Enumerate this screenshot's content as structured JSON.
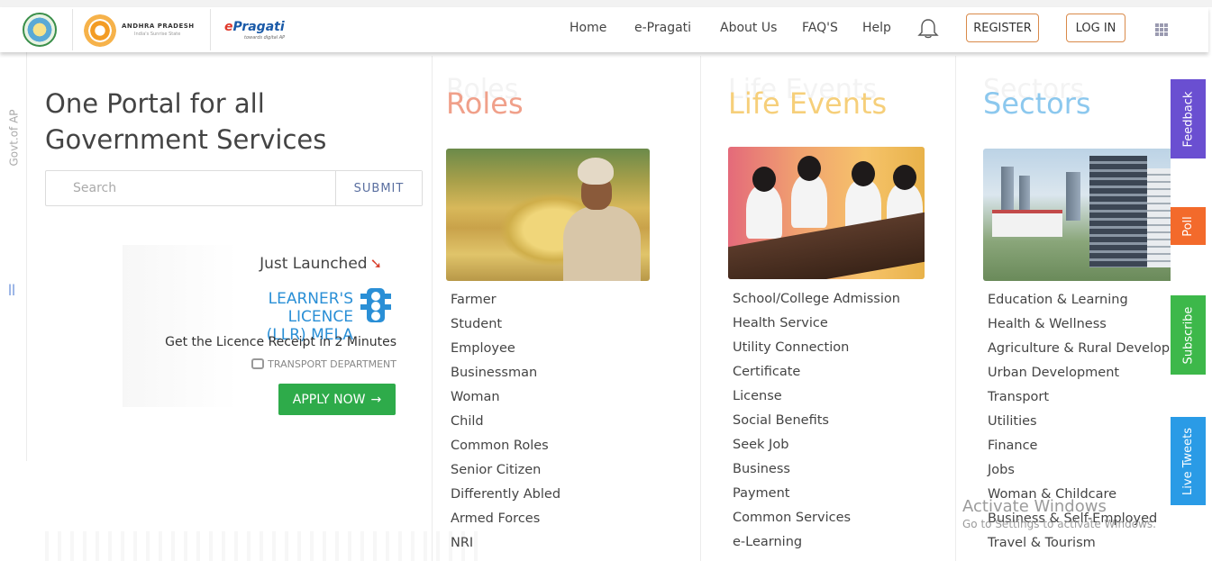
{
  "header": {
    "ap_logo_title": "ANDHRA PRADESH",
    "ap_logo_sub": "India's Sunrise State",
    "ep_logo_e": "e",
    "ep_logo_title": "Pragati",
    "ep_logo_sub": "towards digital AP",
    "nav": [
      "Home",
      "e-Pragati",
      "About Us",
      "FAQ'S",
      "Help"
    ],
    "register_label": "REGISTER",
    "login_label": "LOG IN"
  },
  "rail": {
    "text": "Govt.of AP",
    "marker": "||"
  },
  "hero": {
    "title_line1": "One Portal for all",
    "title_line2": "Government Services",
    "search_placeholder": "Search",
    "submit_label": "SUBMIT"
  },
  "promo": {
    "just_launched": "Just Launched",
    "arrow": "➘",
    "llr_line1": "LEARNER'S LICENCE",
    "llr_line2": "(LLR) MELA",
    "receipt_text": "Get the Licence Receipt in 2 Minutes",
    "department": "TRANSPORT DEPARTMENT",
    "apply_label": "APPLY NOW",
    "apply_arrow": "→"
  },
  "columns": [
    {
      "ghost": "Roles",
      "heading": "Roles",
      "color": "#f0a08a",
      "items": [
        "Farmer",
        "Student",
        "Employee",
        "Businessman",
        "Woman",
        "Child",
        "Common Roles",
        "Senior Citizen",
        "Differently Abled",
        "Armed Forces",
        "NRI"
      ]
    },
    {
      "ghost": "Life Events",
      "heading": "Life Events",
      "color": "#f6cf7a",
      "items": [
        "School/College Admission",
        "Health Service",
        "Utility Connection",
        "Certificate",
        "License",
        "Social Benefits",
        "Seek Job",
        "Business",
        "Payment",
        "Common Services",
        "e-Learning"
      ]
    },
    {
      "ghost": "Sectors",
      "heading": "Sectors",
      "color": "#8cc8ee",
      "items": [
        "Education & Learning",
        "Health & Wellness",
        "Agriculture & Rural Development",
        "Urban Development",
        "Transport",
        "Utilities",
        "Finance",
        "Jobs",
        "Woman & Childcare",
        "Business & Self-Employed",
        "Travel & Tourism"
      ]
    }
  ],
  "side_tabs": [
    {
      "label": "Feedback",
      "color": "#6a4fd1"
    },
    {
      "label": "Poll",
      "color": "#f36a2b"
    },
    {
      "label": "Subscribe",
      "color": "#3db84a"
    },
    {
      "label": "Live Tweets",
      "color": "#2a9be6"
    }
  ],
  "watermark": {
    "line1": "Activate Windows",
    "line2": "Go to Settings to activate Windows."
  }
}
